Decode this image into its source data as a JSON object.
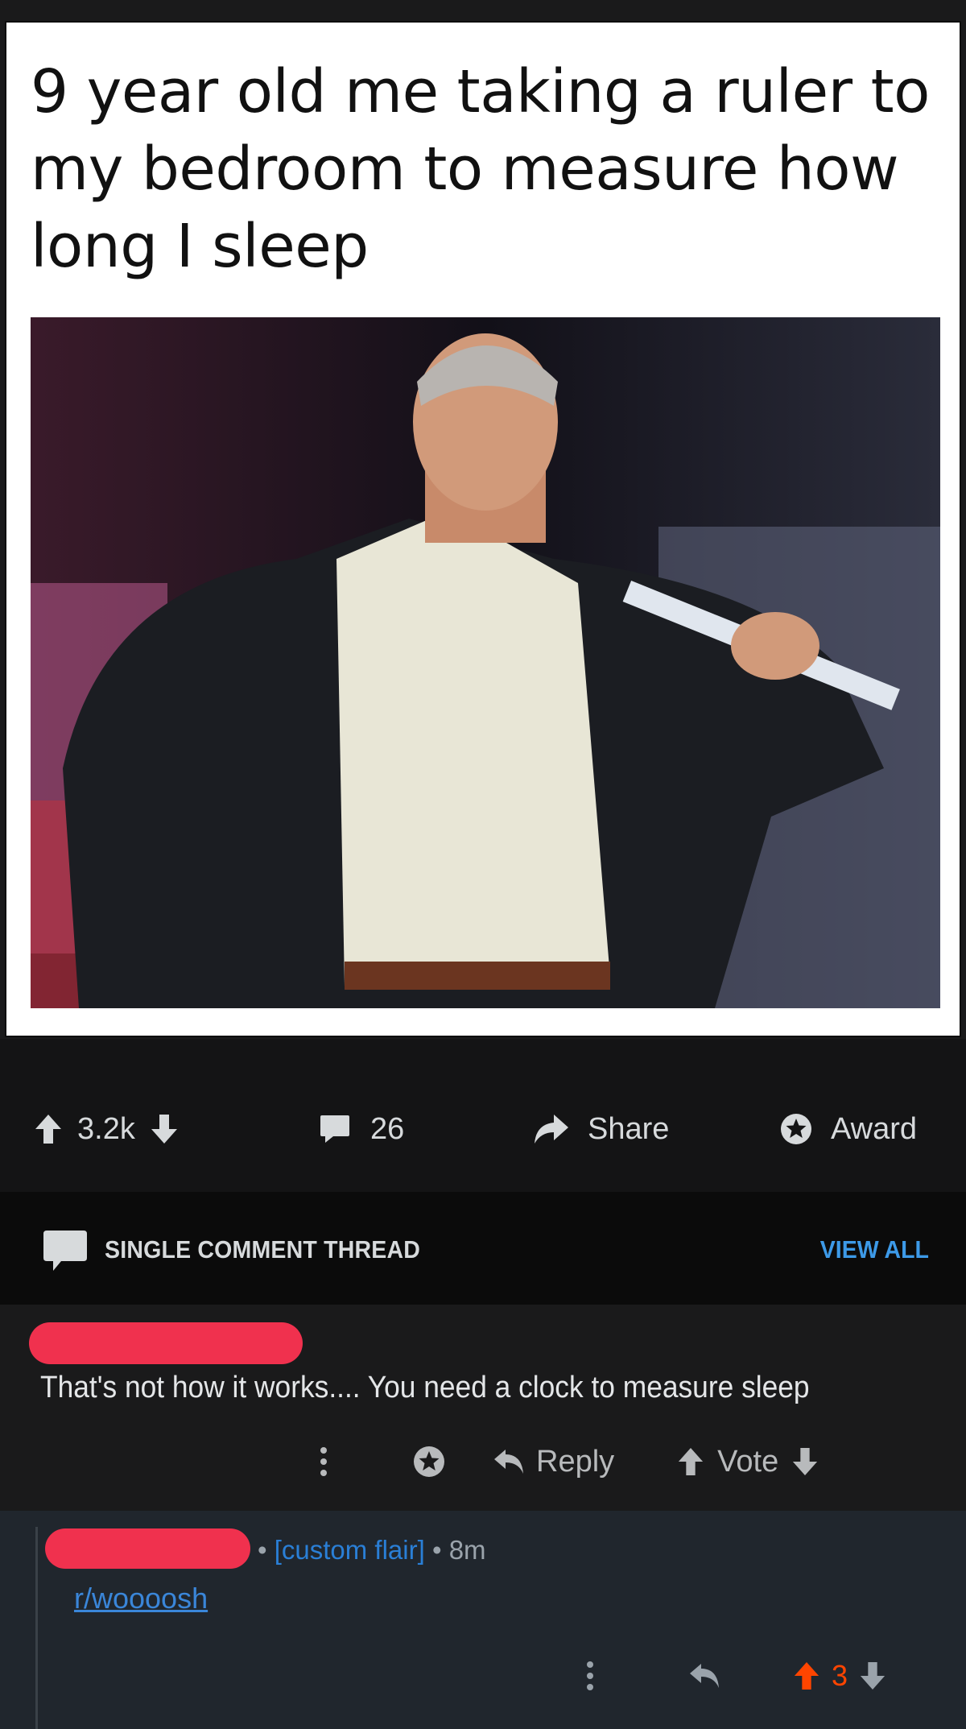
{
  "meme": {
    "caption": "9 year old me taking a ruler to my bedroom to measure how long I sleep"
  },
  "post_actions": {
    "score": "3.2k",
    "comments_count": "26",
    "share_label": "Share",
    "award_label": "Award"
  },
  "thread": {
    "label": "SINGLE COMMENT THREAD",
    "view_all": "VIEW ALL"
  },
  "comment": {
    "body": "That's not how it works.... You need a clock to measure sleep",
    "reply_label": "Reply",
    "vote_label": "Vote"
  },
  "reply": {
    "flair": "[custom flair]",
    "age": "8m",
    "separator": "•",
    "link_text": "r/woooosh",
    "score": "3"
  },
  "colors": {
    "background": "#1a1a1b",
    "accent_blue": "#3d9ae8",
    "upvote_orange": "#ff4500",
    "redaction": "#f0314e"
  },
  "icons": {
    "upvote": "arrow-up-icon",
    "downvote": "arrow-down-icon",
    "comments": "comment-bubble-icon",
    "share": "share-arrow-icon",
    "award": "award-star-icon",
    "thread": "thread-bubble-icon",
    "more": "vertical-dots-icon",
    "reply": "reply-arrow-icon"
  }
}
